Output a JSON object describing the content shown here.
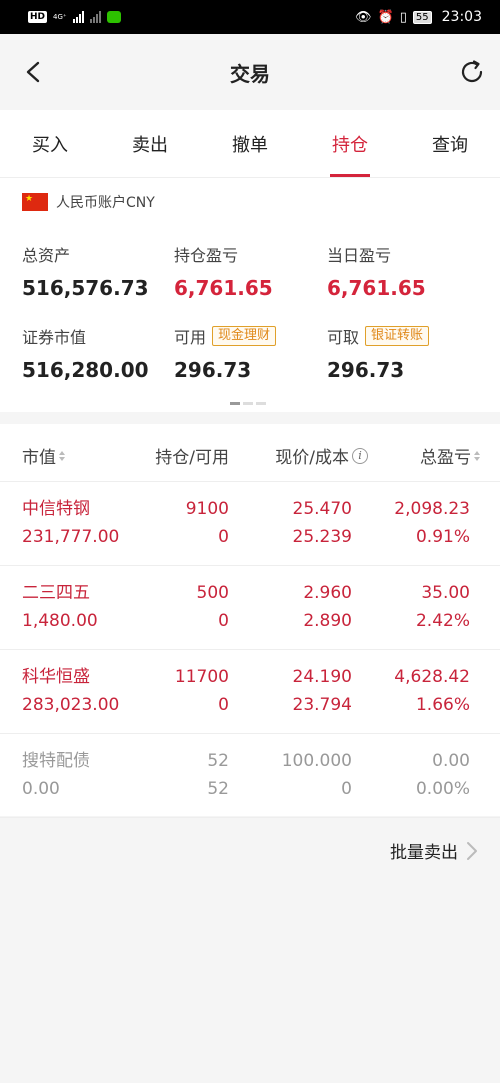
{
  "status_bar": {
    "hd": "HD",
    "network": "4G⁺",
    "time": "23:03",
    "battery": "55"
  },
  "nav": {
    "title": "交易"
  },
  "tabs": [
    {
      "label": "买入",
      "active": false
    },
    {
      "label": "卖出",
      "active": false
    },
    {
      "label": "撤单",
      "active": false
    },
    {
      "label": "持仓",
      "active": true
    },
    {
      "label": "查询",
      "active": false
    }
  ],
  "account": {
    "name": "人民币账户CNY",
    "total_assets_label": "总资产",
    "total_assets": "516,576.73",
    "position_pl_label": "持仓盈亏",
    "position_pl": "6,761.65",
    "daily_pl_label": "当日盈亏",
    "daily_pl": "6,761.65",
    "market_value_label": "证券市值",
    "market_value": "516,280.00",
    "available_label": "可用",
    "available": "296.73",
    "available_action": "现金理财",
    "withdrawable_label": "可取",
    "withdrawable": "296.73",
    "withdrawable_action": "银证转账"
  },
  "table": {
    "headers": {
      "market_value": "市值",
      "position": "持仓/可用",
      "price": "现价/成本",
      "total_pl": "总盈亏"
    },
    "rows": [
      {
        "name": "中信特钢",
        "value": "231,777.00",
        "qty": "9100",
        "available": "0",
        "price": "25.470",
        "cost": "25.239",
        "pl": "2,098.23",
        "pl_pct": "0.91%",
        "color": "red"
      },
      {
        "name": "二三四五",
        "value": "1,480.00",
        "qty": "500",
        "available": "0",
        "price": "2.960",
        "cost": "2.890",
        "pl": "35.00",
        "pl_pct": "2.42%",
        "color": "red"
      },
      {
        "name": "科华恒盛",
        "value": "283,023.00",
        "qty": "11700",
        "available": "0",
        "price": "24.190",
        "cost": "23.794",
        "pl": "4,628.42",
        "pl_pct": "1.66%",
        "color": "red"
      },
      {
        "name": "搜特配债",
        "value": "0.00",
        "qty": "52",
        "available": "52",
        "price": "100.000",
        "cost": "0",
        "pl": "0.00",
        "pl_pct": "0.00%",
        "color": "gray"
      }
    ]
  },
  "batch_sell_label": "批量卖出",
  "colors": {
    "accent": "#d4243b",
    "gain": "#c8243b",
    "neutral": "#999999",
    "pill": "#e0891a"
  }
}
